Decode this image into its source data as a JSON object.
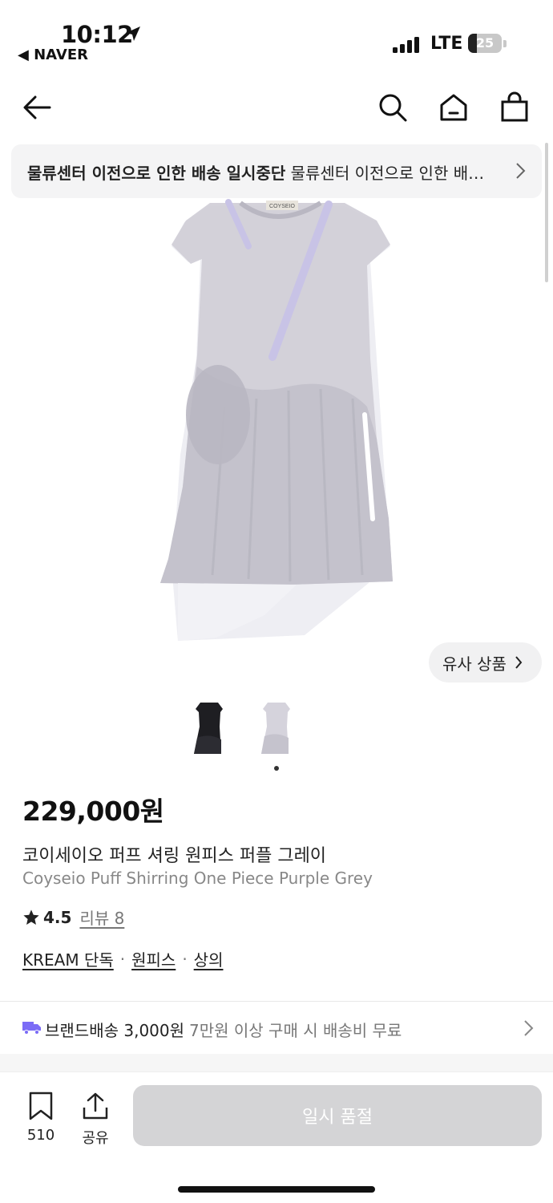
{
  "status_bar": {
    "time": "10:12",
    "back_app": "◀ NAVER",
    "network": "LTE",
    "battery": "25",
    "battery_level": 0.25
  },
  "notice": {
    "bold_text": "물류센터 이전으로 인한 배송 일시중단",
    "detail_text": " 물류센터 이전으로 인한 배…"
  },
  "product": {
    "similar_button": "유사 상품",
    "price": "229,000원",
    "name_ko": "코이세이오 퍼프 셔링 원피스 퍼플 그레이",
    "name_en": "Coyseio Puff Shirring One Piece Purple Grey",
    "rating": "4.5",
    "review_label": "리뷰 8",
    "tags": [
      "KREAM 단독",
      "원피스",
      "상의"
    ],
    "tag_separator": "·",
    "image_label": "COYSEIO"
  },
  "shipping": {
    "label": "브랜드배송 3,000원",
    "note": "7만원 이상 구매 시 배송비 무료"
  },
  "bottom_bar": {
    "bookmark_count": "510",
    "share_label": "공유",
    "buy_label": "일시 품절"
  },
  "colors": {
    "buy_disabled": "#d4d4d6",
    "shipping_icon": "#7b6cf6",
    "dress_primary": "#cfcdd6"
  },
  "icons": [
    "back-arrow-icon",
    "search-icon",
    "home-icon",
    "shopping-bag-icon",
    "chevron-right-icon",
    "star-icon",
    "truck-icon",
    "bookmark-icon",
    "share-icon",
    "location-arrow-icon"
  ]
}
